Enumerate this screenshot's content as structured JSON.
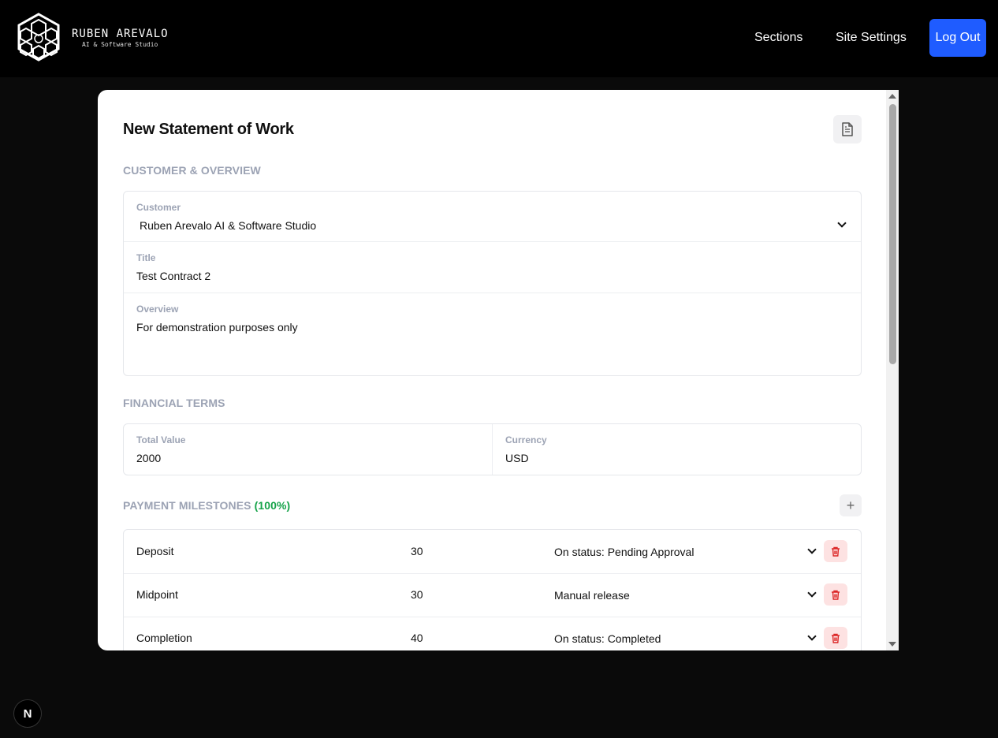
{
  "header": {
    "brand_name": "RUBEN AREVALO",
    "brand_sub": "AI & Software Studio",
    "nav": [
      "Sections",
      "Site Settings"
    ],
    "logout_label": "Log Out",
    "accent": "#1f5cff"
  },
  "form": {
    "title": "New Statement of Work",
    "doc_icon": "document-icon",
    "sections": {
      "customer_overview": "CUSTOMER & OVERVIEW",
      "financial_terms": "FINANCIAL TERMS",
      "payment_milestones": "PAYMENT MILESTONES",
      "milestones_pct": "(100%)"
    },
    "customer": {
      "label": "Customer",
      "value": "Ruben Arevalo AI & Software Studio"
    },
    "title_field": {
      "label": "Title",
      "value": "Test Contract 2"
    },
    "overview": {
      "label": "Overview",
      "value": "For demonstration purposes only"
    },
    "total_value": {
      "label": "Total Value",
      "value": "2000"
    },
    "currency": {
      "label": "Currency",
      "value": "USD"
    },
    "add_milestone_icon": "plus-icon",
    "milestones": [
      {
        "name": "Deposit",
        "percent": "30",
        "trigger": "On status: Pending Approval"
      },
      {
        "name": "Midpoint",
        "percent": "30",
        "trigger": "Manual release"
      },
      {
        "name": "Completion",
        "percent": "40",
        "trigger": "On status: Completed"
      }
    ]
  },
  "colors": {
    "success": "#16a34a",
    "danger": "#dc2626",
    "danger_bg": "#fde2e2"
  },
  "badge": {
    "letter": "N"
  }
}
